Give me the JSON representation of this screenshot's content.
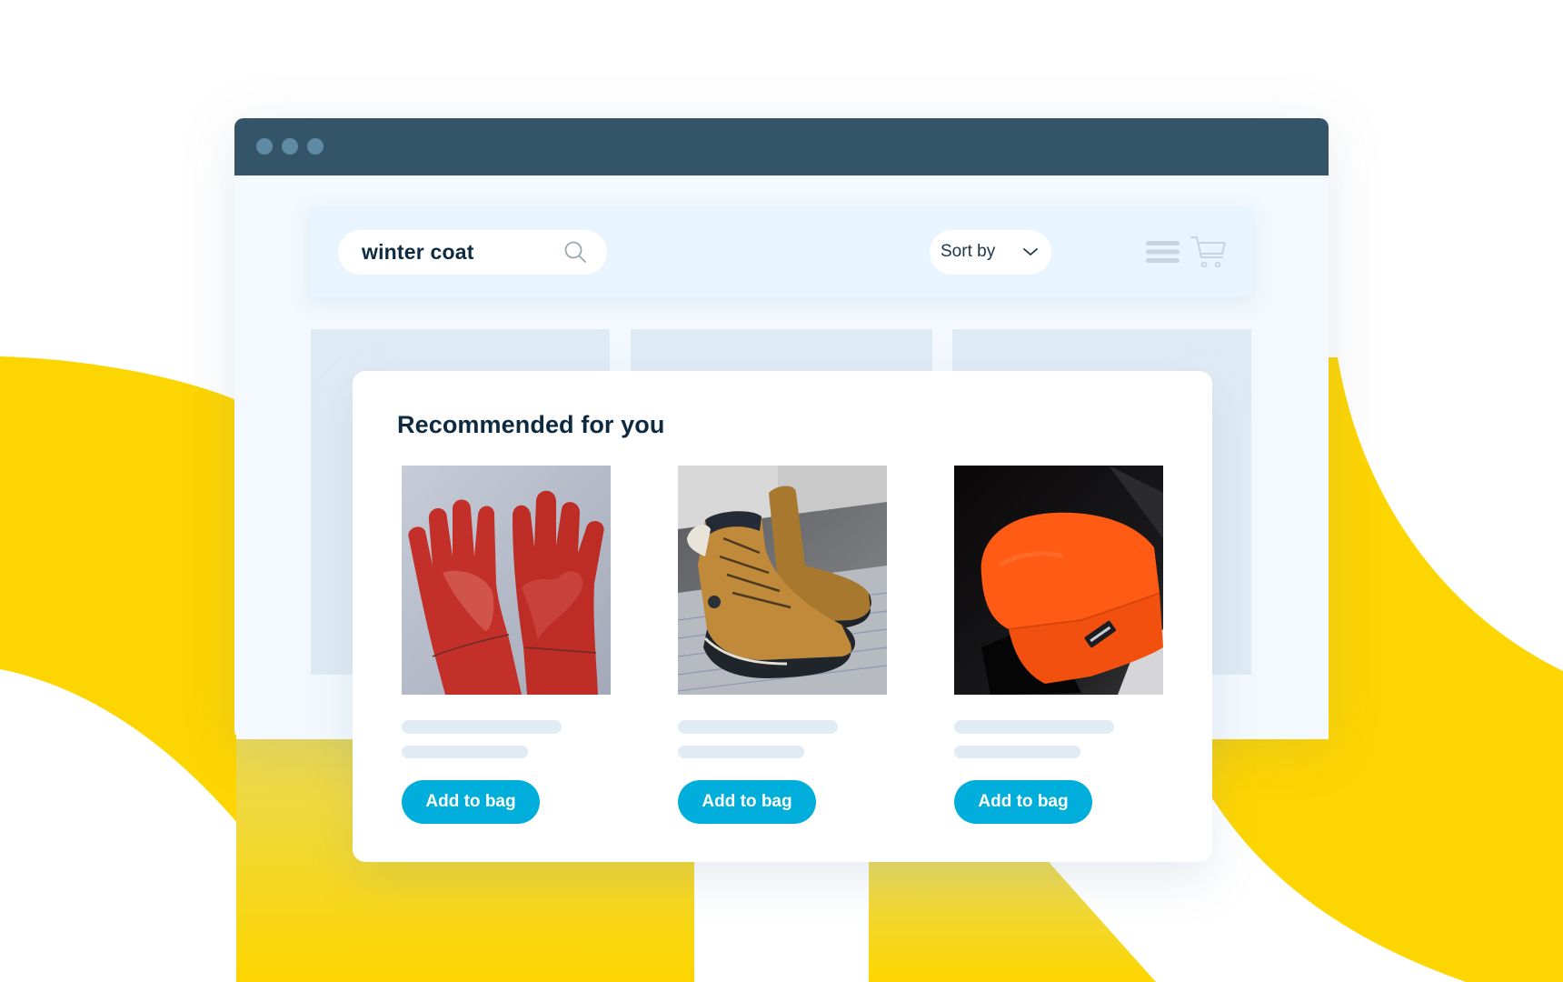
{
  "colors": {
    "accent_yellow": "#FDD500",
    "titlebar": "#345567",
    "window_dot": "#5E8AA3",
    "toolbar_bg": "#E8F5FE",
    "button_blue": "#00AEDB",
    "heading_text": "#0E2A40"
  },
  "window": {
    "controls": [
      "window-dot",
      "window-dot",
      "window-dot"
    ]
  },
  "toolbar": {
    "search": {
      "value": "winter coat",
      "icon": "search-icon"
    },
    "sort": {
      "label": "Sort by",
      "icon": "chevron-down-icon"
    },
    "menu_icon": "hamburger-menu-icon",
    "cart_icon": "shopping-cart-icon"
  },
  "recommendations": {
    "title": "Recommended for you",
    "products": [
      {
        "image": "red leather work gloves",
        "button_label": "Add to bag"
      },
      {
        "image": "tan leather winter boots",
        "button_label": "Add to bag"
      },
      {
        "image": "orange knit beanie",
        "button_label": "Add to bag"
      }
    ]
  }
}
